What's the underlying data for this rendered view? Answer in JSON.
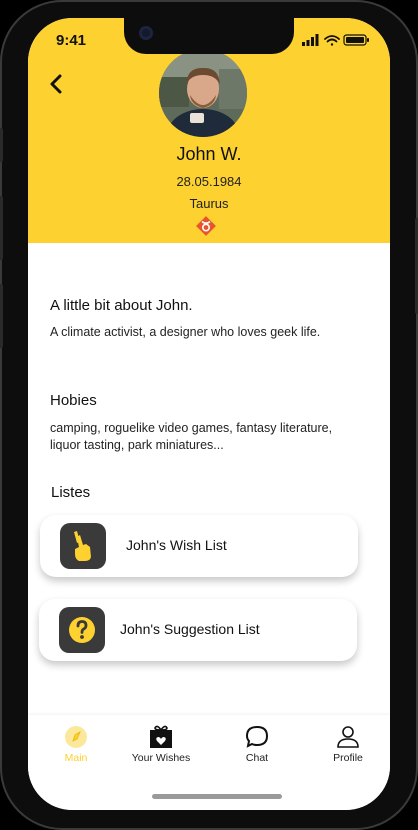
{
  "status_bar": {
    "time": "9:41"
  },
  "profile": {
    "name": "John W.",
    "birthdate": "28.05.1984",
    "zodiac_sign": "Taurus"
  },
  "about": {
    "title": "A little bit about John.",
    "text": "A climate activist, a designer who loves geek life."
  },
  "hobbies": {
    "title": "Hobies",
    "text": "camping, roguelike video games, fantasy literature, liquor tasting, park miniatures..."
  },
  "lists": {
    "title": "Listes",
    "items": [
      {
        "label": "John's Wish List",
        "icon": "fingers-crossed-icon"
      },
      {
        "label": "John's Suggestion List",
        "icon": "question-icon"
      }
    ]
  },
  "tabs": [
    {
      "label": "Main",
      "icon": "compass-icon",
      "active": true
    },
    {
      "label": "Your Wishes",
      "icon": "gift-icon",
      "active": false
    },
    {
      "label": "Chat",
      "icon": "chat-bubble-icon",
      "active": false
    },
    {
      "label": "Profile",
      "icon": "user-icon",
      "active": false
    }
  ],
  "colors": {
    "accent": "#fdd12f",
    "zodiac": "#e8542c",
    "icon_bg": "#3a3a3a"
  }
}
